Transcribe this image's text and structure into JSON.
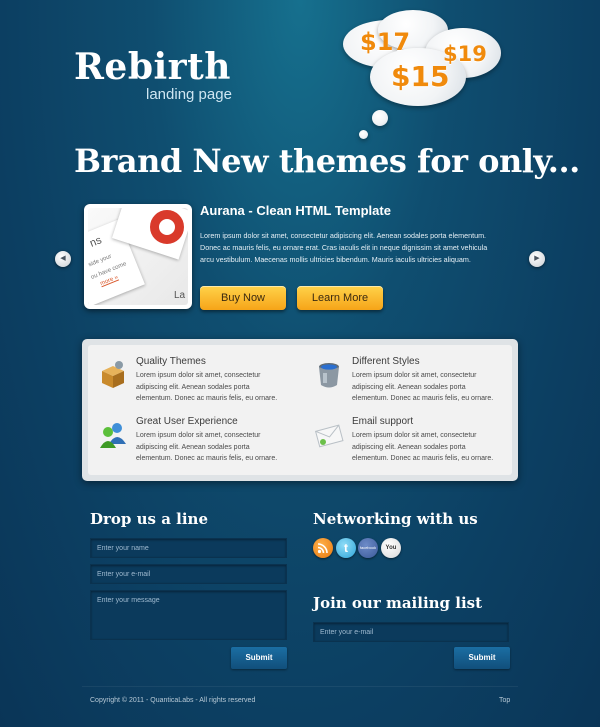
{
  "header": {
    "logo_title": "Rebirth",
    "logo_subtitle": "landing page",
    "prices": [
      "$17",
      "$19",
      "$15"
    ],
    "headline": "Brand New themes for only..."
  },
  "slider": {
    "title": "Aurana - Clean HTML Template",
    "text": "Lorem ipsum dolor sit amet, consectetur adipiscing elit. Aenean sodales porta elementum. Donec ac mauris felis, eu ornare erat. Cras iaculis elit in neque dignissim sit amet vehicula arcu vestibulum. Maecenas mollis ultricies bibendum. Mauris iaculis ultricies aliquam.",
    "buy_now": "Buy Now",
    "learn_more": "Learn More",
    "thumb_text": {
      "a": "ns",
      "b": "side your",
      "c": "ou have come",
      "d": "more »",
      "e": "La"
    }
  },
  "features": [
    {
      "title": "Quality Themes",
      "text": "Lorem ipsum dolor sit amet, consectetur adipiscing elit. Aenean sodales porta elementum. Donec ac mauris felis, eu ornare.",
      "icon": "package-icon"
    },
    {
      "title": "Different Styles",
      "text": "Lorem ipsum dolor sit amet, consectetur adipiscing elit. Aenean sodales porta elementum. Donec ac mauris felis, eu ornare.",
      "icon": "paint-bucket-icon"
    },
    {
      "title": "Great User Experience",
      "text": "Lorem ipsum dolor sit amet, consectetur adipiscing elit. Aenean sodales porta elementum. Donec ac mauris felis, eu ornare.",
      "icon": "users-icon"
    },
    {
      "title": "Email support",
      "text": "Lorem ipsum dolor sit amet, consectetur adipiscing elit. Aenean sodales porta elementum. Donec ac mauris felis, eu ornare.",
      "icon": "envelope-icon"
    }
  ],
  "contact": {
    "title": "Drop us a line",
    "name_placeholder": "Enter your name",
    "email_placeholder": "Enter your e-mail",
    "message_placeholder": "Enter your message",
    "submit": "Submit"
  },
  "networking": {
    "title": "Networking with us",
    "icons": [
      "rss-icon",
      "twitter-icon",
      "facebook-icon",
      "youtube-icon"
    ],
    "facebook_label": "facebook",
    "youtube_label": "You"
  },
  "mailing": {
    "title": "Join our mailing list",
    "email_placeholder": "Enter your e-mail",
    "submit": "Submit"
  },
  "footer": {
    "copyright": "Copyright © 2011 - QuanticaLabs - All rights reserved",
    "top": "Top"
  },
  "colors": {
    "accent": "#f6a418",
    "price": "#f08a0c",
    "background": "#0c3f62"
  }
}
